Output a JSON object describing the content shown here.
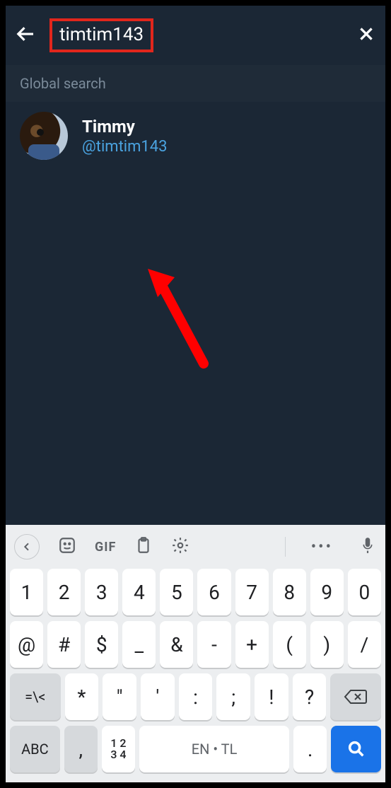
{
  "header": {
    "search_value": "timtim143"
  },
  "section": {
    "label": "Global search"
  },
  "result": {
    "name": "Timmy",
    "handle": "@timtim143"
  },
  "keyboard": {
    "toolbar": {
      "gif": "GIF"
    },
    "row1": [
      "1",
      "2",
      "3",
      "4",
      "5",
      "6",
      "7",
      "8",
      "9",
      "0"
    ],
    "row2": [
      "@",
      "#",
      "$",
      "_",
      "&",
      "-",
      "+",
      "(",
      ")",
      "/"
    ],
    "row3_left": "=\\<",
    "row3": [
      "*",
      "\"",
      "'",
      ":",
      ";",
      "!",
      "?"
    ],
    "row4": {
      "abc": "ABC",
      "comma": ",",
      "numstack": "1 2\n3 4",
      "space": "EN • TL",
      "dot": "."
    }
  }
}
